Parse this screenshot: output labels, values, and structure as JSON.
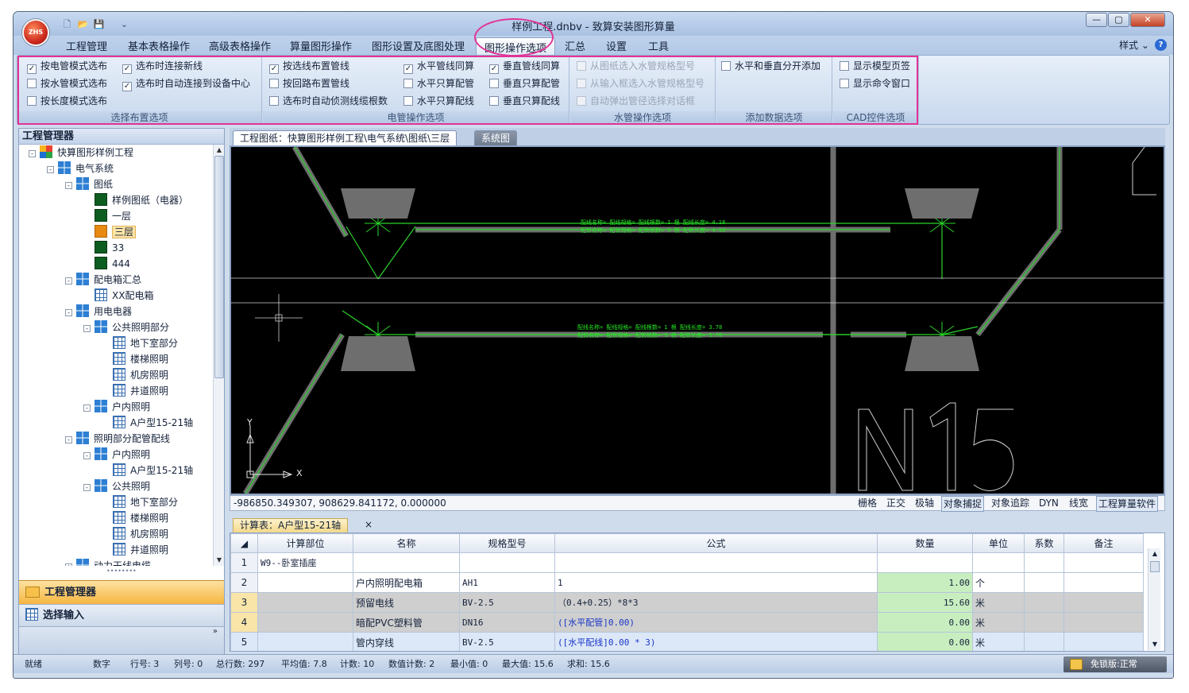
{
  "app": {
    "logo_text": "ZHS",
    "title": "样例工程.dnbv - 致算安装图形算量",
    "window_buttons": [
      "—",
      "▢",
      "✕"
    ]
  },
  "quick_access": [
    "new-icon",
    "open-icon",
    "save-icon",
    "dropdown-icon"
  ],
  "menu": {
    "tabs": [
      "工程管理",
      "基本表格操作",
      "高级表格操作",
      "算量图形操作",
      "图形设置及底图处理",
      "图形操作选项",
      "汇总",
      "设置",
      "工具"
    ],
    "active_tab": "图形操作选项",
    "style_label": "样式",
    "help": "?"
  },
  "ribbon": {
    "groups": [
      {
        "title": "选择布置选项",
        "items": [
          {
            "label": "按电管模式选布",
            "checked": true,
            "enabled": true
          },
          {
            "label": "按水管模式选布",
            "checked": false,
            "enabled": true
          },
          {
            "label": "按长度模式选布",
            "checked": false,
            "enabled": true
          },
          {
            "label": "选布时连接新线",
            "checked": true,
            "enabled": true
          },
          {
            "label": "选布时自动连接到设备中心",
            "checked": true,
            "enabled": true
          }
        ]
      },
      {
        "title": "电管操作选项",
        "items": [
          {
            "label": "按选线布置管线",
            "checked": true,
            "enabled": true
          },
          {
            "label": "按回路布置管线",
            "checked": false,
            "enabled": true
          },
          {
            "label": "选布时自动侦测线缆根数",
            "checked": false,
            "enabled": true
          },
          {
            "label": "水平管线同算",
            "checked": true,
            "enabled": true
          },
          {
            "label": "水平只算配管",
            "checked": false,
            "enabled": true
          },
          {
            "label": "水平只算配线",
            "checked": false,
            "enabled": true
          },
          {
            "label": "垂直管线同算",
            "checked": true,
            "enabled": true
          },
          {
            "label": "垂直只算配管",
            "checked": false,
            "enabled": true
          },
          {
            "label": "垂直只算配线",
            "checked": false,
            "enabled": true
          }
        ]
      },
      {
        "title": "水管操作选项",
        "items": [
          {
            "label": "从图纸选入水管规格型号",
            "checked": false,
            "enabled": false
          },
          {
            "label": "从输入框选入水管规格型号",
            "checked": false,
            "enabled": false
          },
          {
            "label": "自动弹出管径选择对话框",
            "checked": false,
            "enabled": false
          }
        ]
      },
      {
        "title": "添加数据选项",
        "items": [
          {
            "label": "水平和垂直分开添加",
            "checked": false,
            "enabled": true
          }
        ]
      },
      {
        "title": "CAD控件选项",
        "items": [
          {
            "label": "显示模型页签",
            "checked": false,
            "enabled": true
          },
          {
            "label": "显示命令窗口",
            "checked": false,
            "enabled": true
          }
        ]
      }
    ]
  },
  "left_panel": {
    "title": "工程管理器",
    "tree": [
      {
        "label": "快算图形样例工程",
        "level": 0,
        "icon": "windows-logo-icon",
        "toggle": "-"
      },
      {
        "label": "电气系统",
        "level": 1,
        "icon": "folder-grid-icon",
        "toggle": "-"
      },
      {
        "label": "图纸",
        "level": 2,
        "icon": "folder-grid-icon",
        "toggle": "-"
      },
      {
        "label": "样例图纸（电器）",
        "level": 3,
        "icon": "drawing-sheet-icon",
        "toggle": ""
      },
      {
        "label": "一层",
        "level": 3,
        "icon": "drawing-sheet-icon",
        "toggle": ""
      },
      {
        "label": "三层",
        "level": 3,
        "icon": "drawing-sheet-active-icon",
        "toggle": "",
        "selected": true
      },
      {
        "label": "33",
        "level": 3,
        "icon": "drawing-sheet-icon",
        "toggle": ""
      },
      {
        "label": "444",
        "level": 3,
        "icon": "drawing-sheet-icon",
        "toggle": ""
      },
      {
        "label": "配电箱汇总",
        "level": 2,
        "icon": "folder-grid-icon",
        "toggle": "-"
      },
      {
        "label": "XX配电箱",
        "level": 3,
        "icon": "table-icon",
        "toggle": ""
      },
      {
        "label": "用电电器",
        "level": 2,
        "icon": "folder-grid-icon",
        "toggle": "-"
      },
      {
        "label": "公共照明部分",
        "level": 3,
        "icon": "folder-grid-icon",
        "toggle": "-"
      },
      {
        "label": "地下室部分",
        "level": 4,
        "icon": "table-icon",
        "toggle": ""
      },
      {
        "label": "楼梯照明",
        "level": 4,
        "icon": "table-icon",
        "toggle": ""
      },
      {
        "label": "机房照明",
        "level": 4,
        "icon": "table-icon",
        "toggle": ""
      },
      {
        "label": "井道照明",
        "level": 4,
        "icon": "table-icon",
        "toggle": ""
      },
      {
        "label": "户内照明",
        "level": 3,
        "icon": "folder-grid-icon",
        "toggle": "-"
      },
      {
        "label": "A户型15-21轴",
        "level": 4,
        "icon": "table-icon",
        "toggle": ""
      },
      {
        "label": "照明部分配管配线",
        "level": 2,
        "icon": "folder-grid-icon",
        "toggle": "-"
      },
      {
        "label": "户内照明",
        "level": 3,
        "icon": "folder-grid-icon",
        "toggle": "-"
      },
      {
        "label": "A户型15-21轴",
        "level": 4,
        "icon": "table-icon",
        "toggle": ""
      },
      {
        "label": "公共照明",
        "level": 3,
        "icon": "folder-grid-icon",
        "toggle": "-"
      },
      {
        "label": "地下室部分",
        "level": 4,
        "icon": "table-icon",
        "toggle": ""
      },
      {
        "label": "楼梯照明",
        "level": 4,
        "icon": "table-icon",
        "toggle": ""
      },
      {
        "label": "机房照明",
        "level": 4,
        "icon": "table-icon",
        "toggle": ""
      },
      {
        "label": "井道照明",
        "level": 4,
        "icon": "table-icon",
        "toggle": ""
      },
      {
        "label": "动力干线电缆",
        "level": 2,
        "icon": "folder-grid-icon",
        "toggle": "+"
      }
    ],
    "nav": {
      "active": "工程管理器",
      "second": "选择输入",
      "more": "»"
    }
  },
  "drawing": {
    "tabs": [
      "工程图纸：快算图形样例工程\\电气系统\\图纸\\三层",
      "系统图"
    ],
    "annotations": {
      "top1": "配线名称=  配线规格=  配线根数= 1 根  配线长度= 4.18",
      "top2": "配管名称=  配管规格=  配管根数= 3 根  配管长度= 4.18",
      "mid1": "配线名称=  配线规格=  配线根数= 1 根  配线长度= 3.78",
      "mid2": "配管名称=  配管规格=  配管根数= 3 根  配管长度= 3.78"
    },
    "axis_y": "Y",
    "axis_x": "X",
    "big_text": "N15",
    "coords": "-986850.349307,  908629.841172,  0.000000",
    "status_buttons": [
      {
        "label": "栅格",
        "on": false
      },
      {
        "label": "正交",
        "on": false
      },
      {
        "label": "极轴",
        "on": false
      },
      {
        "label": "对象捕捉",
        "on": true
      },
      {
        "label": "对象追踪",
        "on": false
      },
      {
        "label": "DYN",
        "on": false
      },
      {
        "label": "线宽",
        "on": false
      },
      {
        "label": "工程算量软件",
        "on": true
      }
    ]
  },
  "calc": {
    "tab_label": "计算表：A户型15-21轴",
    "close": "×",
    "headers": [
      "计算部位",
      "名称",
      "规格型号",
      "公式",
      "数量",
      "单位",
      "系数",
      "备注"
    ],
    "rows": [
      {
        "n": "1",
        "part": "W9--卧室插座",
        "name": "",
        "spec": "",
        "formula": "",
        "qty": "",
        "unit": "",
        "coef": "",
        "note": "",
        "style": ""
      },
      {
        "n": "2",
        "part": "",
        "name": "户内照明配电箱",
        "spec": "AH1",
        "formula": "1",
        "qty": "1.00",
        "unit": "个",
        "coef": "",
        "note": "",
        "style": ""
      },
      {
        "n": "3",
        "part": "",
        "name": "预留电线",
        "spec": "BV-2.5",
        "formula": "（0.4+0.25）*8*3",
        "qty": "15.60",
        "unit": "米",
        "coef": "",
        "note": "",
        "style": "gray"
      },
      {
        "n": "4",
        "part": "",
        "name": "暗配PVC塑料管",
        "spec": "DN16",
        "formula": "([水平配管]0.00)",
        "qty": "0.00",
        "unit": "米",
        "coef": "",
        "note": "",
        "style": "gray"
      },
      {
        "n": "5",
        "part": "",
        "name": "管内穿线",
        "spec": "BV-2.5",
        "formula": "([水平配线]0.00 * 3)",
        "qty": "0.00",
        "unit": "米",
        "coef": "",
        "note": "",
        "style": "blue"
      }
    ]
  },
  "statusbar": {
    "ready": "就绪",
    "mode": "数字",
    "row": "行号: 3",
    "col": "列号: 0",
    "total": "总行数: 297",
    "avg": "平均值: 7.8",
    "count": "计数: 10",
    "numcount": "数值计数: 2",
    "min": "最小值: 0",
    "max": "最大值: 15.6",
    "sum": "求和: 15.6",
    "license": "免锁版:正常"
  }
}
